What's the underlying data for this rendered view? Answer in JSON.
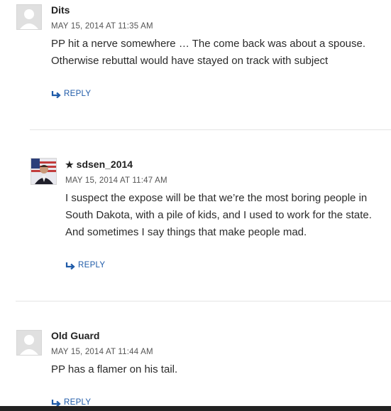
{
  "comments": [
    {
      "author": "Dits",
      "date": "MAY 15, 2014 AT 11:35 AM",
      "text": "PP hit a nerve somewhere … The come back was about a spouse. Otherwise rebuttal would have stayed on track with subject",
      "reply_label": "REPLY",
      "avatar": "default-avatar"
    },
    {
      "author": "sdsen_2014",
      "author_badge": "★",
      "date": "MAY 15, 2014 AT 11:47 AM",
      "text_lines": [
        "I suspect the expose will be that we’re the most boring people in",
        "South Dakota, with a pile of kids, and I used to work for the state.",
        "And sometimes I say things that make people mad."
      ],
      "reply_label": "REPLY",
      "avatar": "photo-avatar"
    },
    {
      "author": "Old Guard",
      "date": "MAY 15, 2014 AT 11:44 AM",
      "text": "PP has a flamer on his tail.",
      "reply_label": "REPLY",
      "avatar": "default-avatar"
    }
  ],
  "colors": {
    "link": "#1e5aa8",
    "divider": "#e5e5e5"
  }
}
